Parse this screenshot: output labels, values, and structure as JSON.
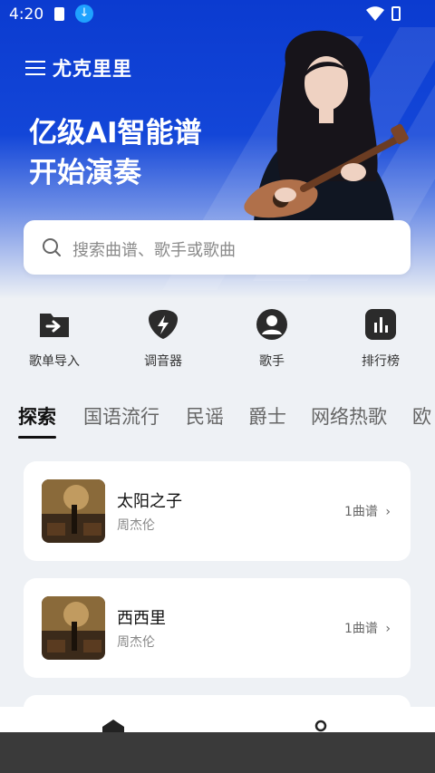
{
  "status_bar": {
    "time": "4:20"
  },
  "brand": {
    "name": "尤克里里"
  },
  "hero": {
    "line1": "亿级AI智能谱",
    "line2": "开始演奏"
  },
  "search": {
    "placeholder": "搜索曲谱、歌手或歌曲"
  },
  "quick_actions": [
    {
      "label": "歌单导入",
      "icon": "import-icon"
    },
    {
      "label": "调音器",
      "icon": "tuner-icon"
    },
    {
      "label": "歌手",
      "icon": "singer-icon"
    },
    {
      "label": "排行榜",
      "icon": "chart-icon"
    }
  ],
  "tabs": [
    "探索",
    "国语流行",
    "民谣",
    "爵士",
    "网络热歌",
    "欧"
  ],
  "songs": [
    {
      "title": "太阳之子",
      "artist": "周杰伦",
      "count": "1曲谱"
    },
    {
      "title": "西西里",
      "artist": "周杰伦",
      "count": "1曲谱"
    }
  ],
  "colors": {
    "brand_blue": "#0b3bd0",
    "background": "#eef1f5"
  }
}
